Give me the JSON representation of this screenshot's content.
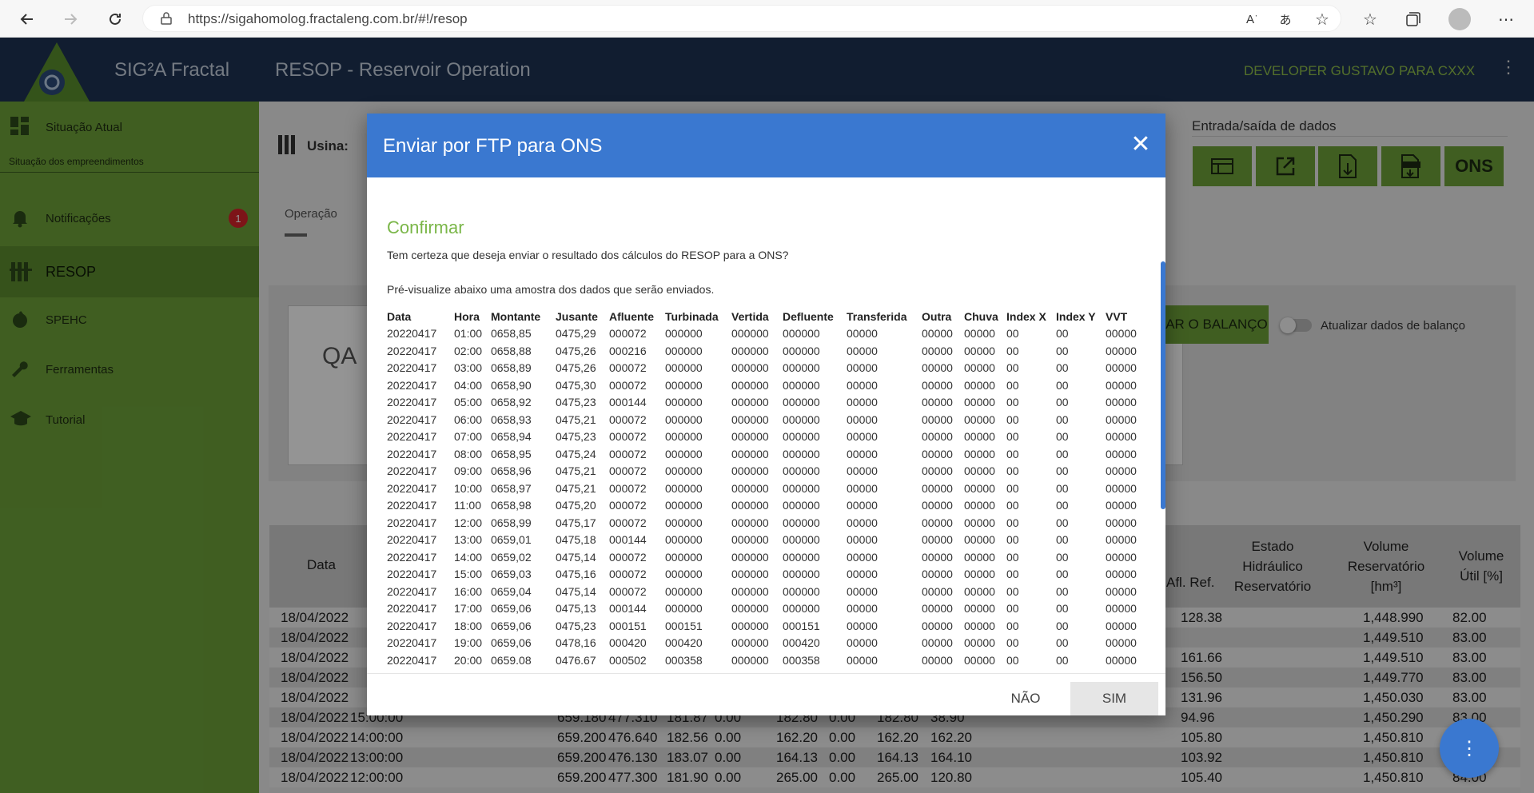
{
  "browser": {
    "url": "https://sigahomolog.fractaleng.com.br/#!/resop"
  },
  "header": {
    "app_title": "SIG²A Fractal",
    "module_title": "RESOP - Reservoir Operation",
    "user": "DEVELOPER GUSTAVO PARA CXXX"
  },
  "sidebar": {
    "situacao": "Situação Atual",
    "subtitle": "Situação dos empreendimentos",
    "notificacoes": "Notificações",
    "badge": "1",
    "resop": "RESOP",
    "spehc": "SPEHC",
    "ferramentas": "Ferramentas",
    "tutorial": "Tutorial"
  },
  "main": {
    "usina_label": "Usina:",
    "tab_operacao": "Operação",
    "io_title": "Entrada/saída de dados",
    "ons_btn": "ONS",
    "qa_text": "QA",
    "balanco_btn": "AR O BALANÇO",
    "atualizar_label": "Atualizar dados de balanço",
    "col_data": "Data",
    "col_afl_ref": "Afl. Ref.",
    "col_estado": "Estado Hidráulico Reservatório",
    "col_volume": "Volume Reservatório [hm³]",
    "col_util": "Volume Útil [%]",
    "rows": [
      {
        "d": "18/04/2022",
        "h": "",
        "a": "",
        "b": "",
        "c": "",
        "e": "",
        "f": "",
        "g": "",
        "i": "",
        "j": "",
        "k": "128.38",
        "v": "1,448.990",
        "u": "82.00"
      },
      {
        "d": "18/04/2022",
        "h": "",
        "a": "",
        "b": "",
        "c": "",
        "e": "",
        "f": "",
        "g": "",
        "i": "",
        "j": "",
        "k": "",
        "v": "1,449.510",
        "u": "83.00"
      },
      {
        "d": "18/04/2022",
        "h": "",
        "a": "",
        "b": "",
        "c": "",
        "e": "",
        "f": "",
        "g": "",
        "i": "",
        "j": "",
        "k": "161.66",
        "v": "1,449.510",
        "u": "83.00"
      },
      {
        "d": "18/04/2022",
        "h": "",
        "a": "",
        "b": "",
        "c": "",
        "e": "",
        "f": "",
        "g": "",
        "i": "",
        "j": "",
        "k": "156.50",
        "v": "1,449.770",
        "u": "83.00"
      },
      {
        "d": "18/04/2022",
        "h": "",
        "a": "",
        "b": "",
        "c": "",
        "e": "",
        "f": "",
        "g": "",
        "i": "",
        "j": "",
        "k": "131.96",
        "v": "1,450.030",
        "u": "83.00"
      },
      {
        "d": "18/04/2022",
        "h": "15:00:00",
        "a": "659.180",
        "b": "477.310",
        "c": "181.87",
        "e": "0.00",
        "f": "182.80",
        "g": "0.00",
        "i": "182.80",
        "j": "38.90",
        "k": "94.96",
        "v": "1,450.290",
        "u": "83.00"
      },
      {
        "d": "18/04/2022",
        "h": "14:00:00",
        "a": "659.200",
        "b": "476.640",
        "c": "182.56",
        "e": "0.00",
        "f": "162.20",
        "g": "0.00",
        "i": "162.20",
        "j": "162.20",
        "k": "105.80",
        "v": "1,450.810",
        "u": "83.00"
      },
      {
        "d": "18/04/2022",
        "h": "13:00:00",
        "a": "659.200",
        "b": "476.130",
        "c": "183.07",
        "e": "0.00",
        "f": "164.13",
        "g": "0.00",
        "i": "164.13",
        "j": "164.10",
        "k": "103.92",
        "v": "1,450.810",
        "u": "83.00"
      },
      {
        "d": "18/04/2022",
        "h": "12:00:00",
        "a": "659.200",
        "b": "477.300",
        "c": "181.90",
        "e": "0.00",
        "f": "265.00",
        "g": "0.00",
        "i": "265.00",
        "j": "120.80",
        "k": "105.40",
        "v": "1,450.810",
        "u": "84.00"
      }
    ]
  },
  "modal": {
    "title": "Enviar por FTP para ONS",
    "confirm": "Confirmar",
    "question": "Tem certeza que deseja enviar o resultado dos cálculos do RESOP para a ONS?",
    "preview": "Pré-visualize abaixo uma amostra dos dados que serão enviados.",
    "headers": [
      "Data",
      "Hora",
      "Montante",
      "Jusante",
      "Afluente",
      "Turbinada",
      "Vertida",
      "Defluente",
      "Transferida",
      "Outra",
      "Chuva",
      "Index X",
      "Index Y",
      "VVT"
    ],
    "rows": [
      [
        "20220417",
        "01:00",
        "0658,85",
        "0475,29",
        "000072",
        "000000",
        "000000",
        "000000",
        "00000",
        "00000",
        "00000",
        "00",
        "00",
        "00000"
      ],
      [
        "20220417",
        "02:00",
        "0658,88",
        "0475,26",
        "000216",
        "000000",
        "000000",
        "000000",
        "00000",
        "00000",
        "00000",
        "00",
        "00",
        "00000"
      ],
      [
        "20220417",
        "03:00",
        "0658,89",
        "0475,26",
        "000072",
        "000000",
        "000000",
        "000000",
        "00000",
        "00000",
        "00000",
        "00",
        "00",
        "00000"
      ],
      [
        "20220417",
        "04:00",
        "0658,90",
        "0475,30",
        "000072",
        "000000",
        "000000",
        "000000",
        "00000",
        "00000",
        "00000",
        "00",
        "00",
        "00000"
      ],
      [
        "20220417",
        "05:00",
        "0658,92",
        "0475,23",
        "000144",
        "000000",
        "000000",
        "000000",
        "00000",
        "00000",
        "00000",
        "00",
        "00",
        "00000"
      ],
      [
        "20220417",
        "06:00",
        "0658,93",
        "0475,21",
        "000072",
        "000000",
        "000000",
        "000000",
        "00000",
        "00000",
        "00000",
        "00",
        "00",
        "00000"
      ],
      [
        "20220417",
        "07:00",
        "0658,94",
        "0475,23",
        "000072",
        "000000",
        "000000",
        "000000",
        "00000",
        "00000",
        "00000",
        "00",
        "00",
        "00000"
      ],
      [
        "20220417",
        "08:00",
        "0658,95",
        "0475,24",
        "000072",
        "000000",
        "000000",
        "000000",
        "00000",
        "00000",
        "00000",
        "00",
        "00",
        "00000"
      ],
      [
        "20220417",
        "09:00",
        "0658,96",
        "0475,21",
        "000072",
        "000000",
        "000000",
        "000000",
        "00000",
        "00000",
        "00000",
        "00",
        "00",
        "00000"
      ],
      [
        "20220417",
        "10:00",
        "0658,97",
        "0475,21",
        "000072",
        "000000",
        "000000",
        "000000",
        "00000",
        "00000",
        "00000",
        "00",
        "00",
        "00000"
      ],
      [
        "20220417",
        "11:00",
        "0658,98",
        "0475,20",
        "000072",
        "000000",
        "000000",
        "000000",
        "00000",
        "00000",
        "00000",
        "00",
        "00",
        "00000"
      ],
      [
        "20220417",
        "12:00",
        "0658,99",
        "0475,17",
        "000072",
        "000000",
        "000000",
        "000000",
        "00000",
        "00000",
        "00000",
        "00",
        "00",
        "00000"
      ],
      [
        "20220417",
        "13:00",
        "0659,01",
        "0475,18",
        "000144",
        "000000",
        "000000",
        "000000",
        "00000",
        "00000",
        "00000",
        "00",
        "00",
        "00000"
      ],
      [
        "20220417",
        "14:00",
        "0659,02",
        "0475,14",
        "000072",
        "000000",
        "000000",
        "000000",
        "00000",
        "00000",
        "00000",
        "00",
        "00",
        "00000"
      ],
      [
        "20220417",
        "15:00",
        "0659,03",
        "0475,16",
        "000072",
        "000000",
        "000000",
        "000000",
        "00000",
        "00000",
        "00000",
        "00",
        "00",
        "00000"
      ],
      [
        "20220417",
        "16:00",
        "0659,04",
        "0475,14",
        "000072",
        "000000",
        "000000",
        "000000",
        "00000",
        "00000",
        "00000",
        "00",
        "00",
        "00000"
      ],
      [
        "20220417",
        "17:00",
        "0659,06",
        "0475,13",
        "000144",
        "000000",
        "000000",
        "000000",
        "00000",
        "00000",
        "00000",
        "00",
        "00",
        "00000"
      ],
      [
        "20220417",
        "18:00",
        "0659,06",
        "0475,23",
        "000151",
        "000151",
        "000000",
        "000151",
        "00000",
        "00000",
        "00000",
        "00",
        "00",
        "00000"
      ],
      [
        "20220417",
        "19:00",
        "0659,06",
        "0478,16",
        "000420",
        "000420",
        "000000",
        "000420",
        "00000",
        "00000",
        "00000",
        "00",
        "00",
        "00000"
      ],
      [
        "20220417",
        "20:00",
        "0659.08",
        "0476.67",
        "000502",
        "000358",
        "000000",
        "000358",
        "00000",
        "00000",
        "00000",
        "00",
        "00",
        "00000"
      ]
    ],
    "btn_no": "NÃO",
    "btn_yes": "SIM"
  }
}
